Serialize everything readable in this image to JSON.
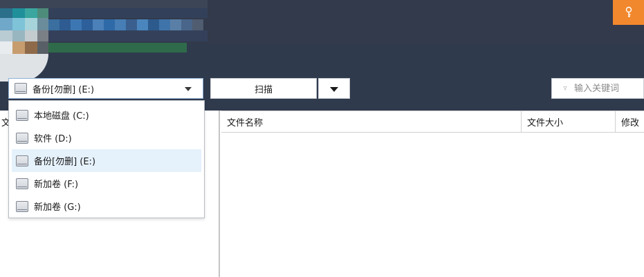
{
  "colors": {
    "header_bg": "#2f3a4d",
    "accent_orange": "#f2882d",
    "selected_bg": "#e5f1fb",
    "select_border": "#8fb1d6"
  },
  "header": {
    "key_icon": "key-icon"
  },
  "toolbar": {
    "drive_select_value": "备份[勿删] (E:)",
    "scan_label": "扫描",
    "search_placeholder": "输入关键词"
  },
  "drives": [
    {
      "label": "本地磁盘 (C:)",
      "selected": false
    },
    {
      "label": "软件 (D:)",
      "selected": false
    },
    {
      "label": "备份[勿删] (E:)",
      "selected": true
    },
    {
      "label": "新加卷 (F:)",
      "selected": false
    },
    {
      "label": "新加卷 (G:)",
      "selected": false
    }
  ],
  "left_pane": {
    "header_partial": "文"
  },
  "file_list": {
    "columns": [
      "文件名称",
      "文件大小",
      "修改"
    ]
  }
}
